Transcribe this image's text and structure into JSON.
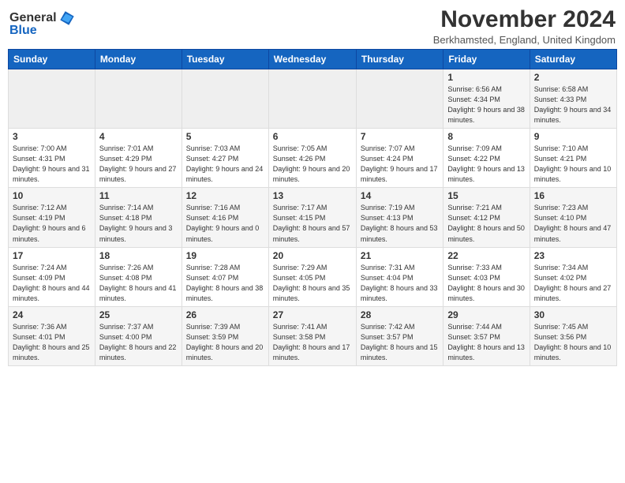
{
  "header": {
    "logo_general": "General",
    "logo_blue": "Blue",
    "month_title": "November 2024",
    "location": "Berkhamsted, England, United Kingdom"
  },
  "days_of_week": [
    "Sunday",
    "Monday",
    "Tuesday",
    "Wednesday",
    "Thursday",
    "Friday",
    "Saturday"
  ],
  "weeks": [
    [
      {
        "day": "",
        "info": ""
      },
      {
        "day": "",
        "info": ""
      },
      {
        "day": "",
        "info": ""
      },
      {
        "day": "",
        "info": ""
      },
      {
        "day": "",
        "info": ""
      },
      {
        "day": "1",
        "info": "Sunrise: 6:56 AM\nSunset: 4:34 PM\nDaylight: 9 hours and 38 minutes."
      },
      {
        "day": "2",
        "info": "Sunrise: 6:58 AM\nSunset: 4:33 PM\nDaylight: 9 hours and 34 minutes."
      }
    ],
    [
      {
        "day": "3",
        "info": "Sunrise: 7:00 AM\nSunset: 4:31 PM\nDaylight: 9 hours and 31 minutes."
      },
      {
        "day": "4",
        "info": "Sunrise: 7:01 AM\nSunset: 4:29 PM\nDaylight: 9 hours and 27 minutes."
      },
      {
        "day": "5",
        "info": "Sunrise: 7:03 AM\nSunset: 4:27 PM\nDaylight: 9 hours and 24 minutes."
      },
      {
        "day": "6",
        "info": "Sunrise: 7:05 AM\nSunset: 4:26 PM\nDaylight: 9 hours and 20 minutes."
      },
      {
        "day": "7",
        "info": "Sunrise: 7:07 AM\nSunset: 4:24 PM\nDaylight: 9 hours and 17 minutes."
      },
      {
        "day": "8",
        "info": "Sunrise: 7:09 AM\nSunset: 4:22 PM\nDaylight: 9 hours and 13 minutes."
      },
      {
        "day": "9",
        "info": "Sunrise: 7:10 AM\nSunset: 4:21 PM\nDaylight: 9 hours and 10 minutes."
      }
    ],
    [
      {
        "day": "10",
        "info": "Sunrise: 7:12 AM\nSunset: 4:19 PM\nDaylight: 9 hours and 6 minutes."
      },
      {
        "day": "11",
        "info": "Sunrise: 7:14 AM\nSunset: 4:18 PM\nDaylight: 9 hours and 3 minutes."
      },
      {
        "day": "12",
        "info": "Sunrise: 7:16 AM\nSunset: 4:16 PM\nDaylight: 9 hours and 0 minutes."
      },
      {
        "day": "13",
        "info": "Sunrise: 7:17 AM\nSunset: 4:15 PM\nDaylight: 8 hours and 57 minutes."
      },
      {
        "day": "14",
        "info": "Sunrise: 7:19 AM\nSunset: 4:13 PM\nDaylight: 8 hours and 53 minutes."
      },
      {
        "day": "15",
        "info": "Sunrise: 7:21 AM\nSunset: 4:12 PM\nDaylight: 8 hours and 50 minutes."
      },
      {
        "day": "16",
        "info": "Sunrise: 7:23 AM\nSunset: 4:10 PM\nDaylight: 8 hours and 47 minutes."
      }
    ],
    [
      {
        "day": "17",
        "info": "Sunrise: 7:24 AM\nSunset: 4:09 PM\nDaylight: 8 hours and 44 minutes."
      },
      {
        "day": "18",
        "info": "Sunrise: 7:26 AM\nSunset: 4:08 PM\nDaylight: 8 hours and 41 minutes."
      },
      {
        "day": "19",
        "info": "Sunrise: 7:28 AM\nSunset: 4:07 PM\nDaylight: 8 hours and 38 minutes."
      },
      {
        "day": "20",
        "info": "Sunrise: 7:29 AM\nSunset: 4:05 PM\nDaylight: 8 hours and 35 minutes."
      },
      {
        "day": "21",
        "info": "Sunrise: 7:31 AM\nSunset: 4:04 PM\nDaylight: 8 hours and 33 minutes."
      },
      {
        "day": "22",
        "info": "Sunrise: 7:33 AM\nSunset: 4:03 PM\nDaylight: 8 hours and 30 minutes."
      },
      {
        "day": "23",
        "info": "Sunrise: 7:34 AM\nSunset: 4:02 PM\nDaylight: 8 hours and 27 minutes."
      }
    ],
    [
      {
        "day": "24",
        "info": "Sunrise: 7:36 AM\nSunset: 4:01 PM\nDaylight: 8 hours and 25 minutes."
      },
      {
        "day": "25",
        "info": "Sunrise: 7:37 AM\nSunset: 4:00 PM\nDaylight: 8 hours and 22 minutes."
      },
      {
        "day": "26",
        "info": "Sunrise: 7:39 AM\nSunset: 3:59 PM\nDaylight: 8 hours and 20 minutes."
      },
      {
        "day": "27",
        "info": "Sunrise: 7:41 AM\nSunset: 3:58 PM\nDaylight: 8 hours and 17 minutes."
      },
      {
        "day": "28",
        "info": "Sunrise: 7:42 AM\nSunset: 3:57 PM\nDaylight: 8 hours and 15 minutes."
      },
      {
        "day": "29",
        "info": "Sunrise: 7:44 AM\nSunset: 3:57 PM\nDaylight: 8 hours and 13 minutes."
      },
      {
        "day": "30",
        "info": "Sunrise: 7:45 AM\nSunset: 3:56 PM\nDaylight: 8 hours and 10 minutes."
      }
    ]
  ]
}
